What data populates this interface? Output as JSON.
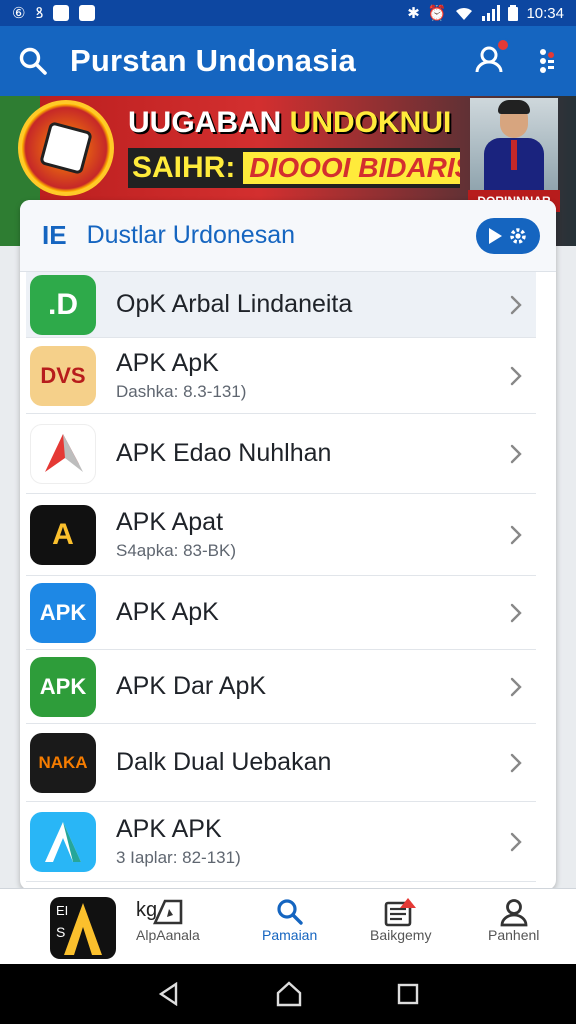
{
  "status_bar": {
    "time": "10:34",
    "left_glyphs": [
      "⑥",
      "ꝸ"
    ]
  },
  "app_bar": {
    "title": "Purstan Undonasia"
  },
  "banner": {
    "line1_a": "UUGABAN",
    "line1_b": "UNDOKNUI",
    "line2_a": "SAIHR:",
    "line2_b": "DIOOOI BIDARISI",
    "photo_caption": "DORINNNAR"
  },
  "card": {
    "header_short": "IE",
    "header_title": "Dustlar Urdonesan"
  },
  "list": [
    {
      "title": "OpK Arbal Lindaneita",
      "subtitle": "",
      "icon_text": ".D",
      "icon_bg": "#2eaa4a",
      "icon_fg": "#ffffff"
    },
    {
      "title": "APK ApK",
      "subtitle": "Dashka: 8.3-131)",
      "icon_text": "DVS",
      "icon_bg": "#f5d08a",
      "icon_fg": "#b71c1c"
    },
    {
      "title": "APK Edao Nuhlhan",
      "subtitle": "",
      "icon_text": "",
      "icon_bg": "#ffffff",
      "icon_fg": "#e53935"
    },
    {
      "title": "APK Apat",
      "subtitle": "S4apka: 83-BK)",
      "icon_text": "A",
      "icon_bg": "#111111",
      "icon_fg": "#fbc02d"
    },
    {
      "title": "APK ApK",
      "subtitle": "",
      "icon_text": "APK",
      "icon_bg": "#1e88e5",
      "icon_fg": "#ffffff"
    },
    {
      "title": "APK Dar ApK",
      "subtitle": "",
      "icon_text": "APK",
      "icon_bg": "#2e9d3a",
      "icon_fg": "#ffffff"
    },
    {
      "title": "Dalk Dual Uebakan",
      "subtitle": "",
      "icon_text": "NAKA",
      "icon_bg": "#1a1a1a",
      "icon_fg": "#f57c00"
    },
    {
      "title": "APK APK",
      "subtitle": "3 Iaplar: 82-131)",
      "icon_text": "",
      "icon_bg": "#29b6f6",
      "icon_fg": "#ffffff"
    }
  ],
  "bottom_nav": {
    "thumb_label_top": "kg",
    "items": [
      {
        "label": "AlpAanala"
      },
      {
        "label": "Pamaian"
      },
      {
        "label": "Baikgemy"
      },
      {
        "label": "Panhenl"
      }
    ]
  },
  "colors": {
    "primary": "#1565c0",
    "status": "#0d47a1",
    "accent_red": "#e53935"
  }
}
